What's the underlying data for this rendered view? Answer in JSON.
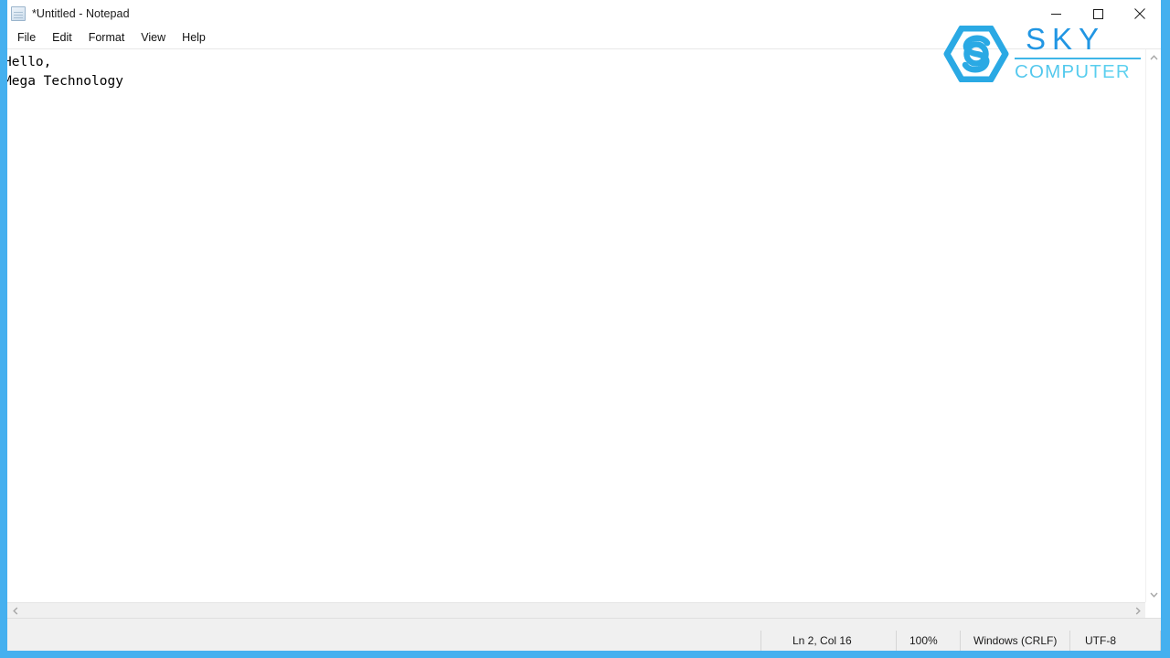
{
  "window": {
    "title": "*Untitled - Notepad",
    "icon": "notepad-icon",
    "border_color": "#45b0ef",
    "controls": {
      "minimize": "minimize-icon",
      "maximize": "maximize-icon",
      "close": "close-icon"
    }
  },
  "menubar": {
    "items": [
      {
        "label": "File"
      },
      {
        "label": "Edit"
      },
      {
        "label": "Format"
      },
      {
        "label": "View"
      },
      {
        "label": "Help"
      }
    ]
  },
  "editor": {
    "content": "Hello,\nMega Technology",
    "lines": [
      "Hello,",
      "Mega Technology"
    ]
  },
  "scrollbars": {
    "vertical_up": "chevron-up-icon",
    "vertical_down": "chevron-down-icon",
    "horizontal_left": "chevron-left-icon",
    "horizontal_right": "chevron-right-icon"
  },
  "statusbar": {
    "position": "Ln 2, Col 16",
    "zoom": "100%",
    "line_ending": "Windows (CRLF)",
    "encoding": "UTF-8"
  },
  "logo": {
    "mark": "sky-hexagon-s-icon",
    "primary_text": "SKY",
    "secondary_text": "COMPUTER",
    "primary_color": "#2196e3",
    "secondary_color": "#57cdee"
  }
}
